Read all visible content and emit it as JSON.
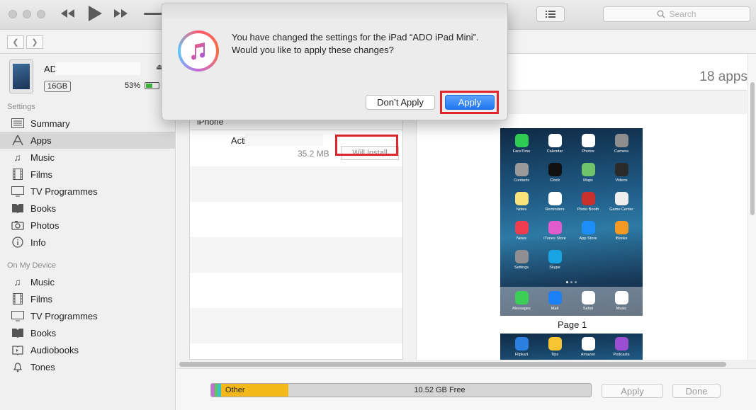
{
  "search": {
    "placeholder": "Search"
  },
  "sidebar": {
    "device_name": "AD",
    "capacity": "16GB",
    "battery": "53%",
    "settings_heading": "Settings",
    "settings_items": [
      {
        "label": "Summary",
        "icon": "summary-icon"
      },
      {
        "label": "Apps",
        "icon": "apps-icon"
      },
      {
        "label": "Music",
        "icon": "music-note-icon"
      },
      {
        "label": "Films",
        "icon": "film-icon"
      },
      {
        "label": "TV Programmes",
        "icon": "tv-icon"
      },
      {
        "label": "Books",
        "icon": "book-icon"
      },
      {
        "label": "Photos",
        "icon": "camera-icon"
      },
      {
        "label": "Info",
        "icon": "info-icon"
      }
    ],
    "device_heading": "On My Device",
    "device_items": [
      {
        "label": "Music",
        "icon": "music-note-icon"
      },
      {
        "label": "Films",
        "icon": "film-icon"
      },
      {
        "label": "TV Programmes",
        "icon": "tv-icon"
      },
      {
        "label": "Books",
        "icon": "book-icon"
      },
      {
        "label": "Audiobooks",
        "icon": "audiobook-icon"
      },
      {
        "label": "Tones",
        "icon": "bell-icon"
      }
    ]
  },
  "main": {
    "apps_count": "18 apps",
    "list_header": "iPhone",
    "app_row": {
      "name": "Acti",
      "size": "35.2 MB",
      "status": "Will Install"
    },
    "page_label": "Page 1",
    "home_apps": [
      {
        "label": "FaceTime",
        "color": "#2ecc52"
      },
      {
        "label": "Calendar",
        "color": "#ffffff"
      },
      {
        "label": "Photos",
        "color": "#ffffff"
      },
      {
        "label": "Camera",
        "color": "#8e8e8e"
      },
      {
        "label": "Contacts",
        "color": "#9a9a9a"
      },
      {
        "label": "Clock",
        "color": "#111111"
      },
      {
        "label": "Maps",
        "color": "#6fc36a"
      },
      {
        "label": "Videos",
        "color": "#2a2a2a"
      },
      {
        "label": "Notes",
        "color": "#f8e27a"
      },
      {
        "label": "Reminders",
        "color": "#ffffff"
      },
      {
        "label": "Photo Booth",
        "color": "#c7302c"
      },
      {
        "label": "Game Center",
        "color": "#eeeeee"
      },
      {
        "label": "News",
        "color": "#ee3d4e"
      },
      {
        "label": "iTunes Store",
        "color": "#e05ccc"
      },
      {
        "label": "App Store",
        "color": "#1d8ef6"
      },
      {
        "label": "iBooks",
        "color": "#f49a24"
      },
      {
        "label": "Settings",
        "color": "#8e8e93"
      },
      {
        "label": "Skype",
        "color": "#18a4e3"
      }
    ],
    "dock_apps": [
      {
        "label": "Messages",
        "color": "#3ccf58"
      },
      {
        "label": "Mail",
        "color": "#1b7ff6"
      },
      {
        "label": "Safari",
        "color": "#ffffff"
      },
      {
        "label": "Music",
        "color": "#ffffff"
      }
    ],
    "page2_apps": [
      {
        "label": "Flipkart",
        "color": "#2a7fe0"
      },
      {
        "label": "Tips",
        "color": "#f7c531"
      },
      {
        "label": "Amazon",
        "color": "#ffffff"
      },
      {
        "label": "Podcasts",
        "color": "#9a4fd3"
      }
    ],
    "storage": {
      "other_label": "Other",
      "free_label": "10.52 GB Free"
    },
    "apply_label": "Apply",
    "done_label": "Done"
  },
  "dialog": {
    "message": "You have changed the settings for the iPad “ADO iPad Mini”. Would you like to apply these changes?",
    "dont_apply": "Don’t Apply",
    "apply": "Apply"
  },
  "colors": {
    "highlight_red": "#e0262c",
    "primary_blue": "#2176f2",
    "storage_other": "#f4b81b"
  }
}
